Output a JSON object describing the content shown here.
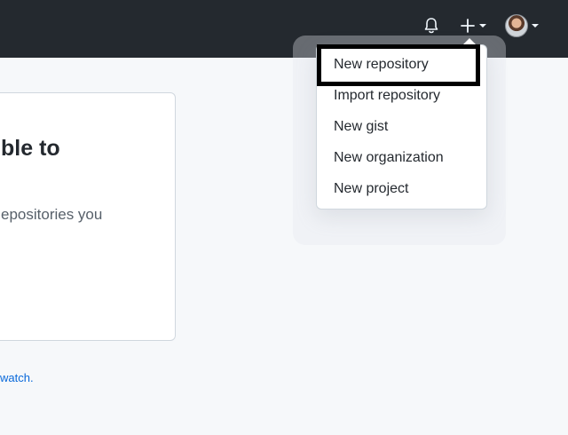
{
  "header": {
    "icons": {
      "bell": "bell-icon",
      "plus": "plus-icon",
      "avatar": "avatar"
    }
  },
  "card": {
    "title_fragment": "ble to",
    "text_fragment": "epositories you"
  },
  "footer": {
    "link_fragment": "watch."
  },
  "dropdown": {
    "items": [
      {
        "label": "New repository"
      },
      {
        "label": "Import repository"
      },
      {
        "label": "New gist"
      },
      {
        "label": "New organization"
      },
      {
        "label": "New project"
      }
    ]
  },
  "colors": {
    "header_bg": "#24292f",
    "page_bg": "#f6f8fa",
    "link": "#0969da",
    "highlight": "#000000"
  }
}
